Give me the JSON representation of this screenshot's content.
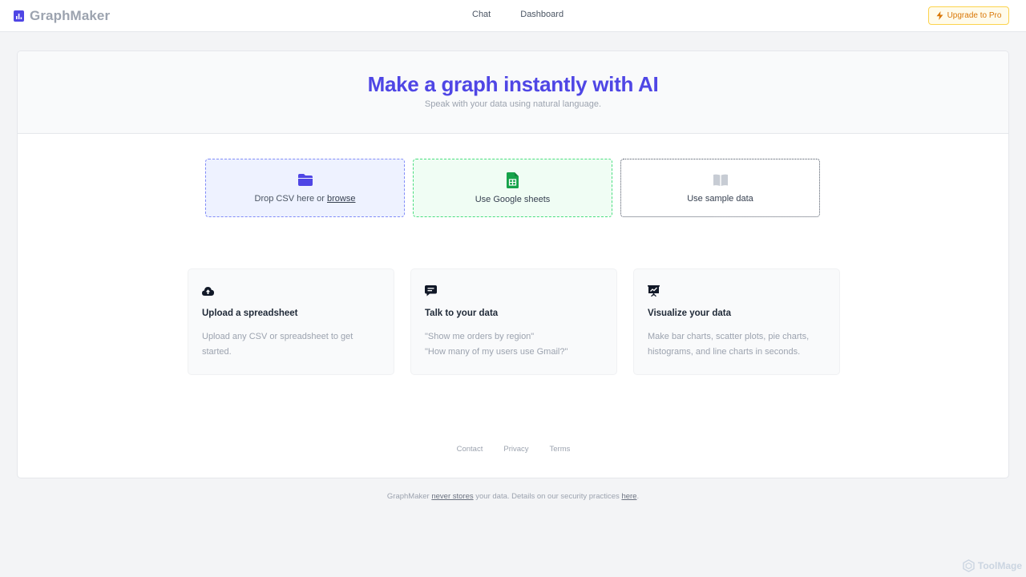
{
  "brand": {
    "name": "GraphMaker"
  },
  "nav": {
    "chat": "Chat",
    "dashboard": "Dashboard"
  },
  "upgrade": {
    "label": "Upgrade to Pro"
  },
  "hero": {
    "title": "Make a graph instantly with AI",
    "subtitle": "Speak with your data using natural language."
  },
  "sources": {
    "csv_prefix": "Drop CSV here or ",
    "csv_link": "browse",
    "sheets": "Use Google sheets",
    "sample": "Use sample data"
  },
  "features": [
    {
      "title": "Upload a spreadsheet",
      "line1": "Upload any CSV or spreadsheet to get",
      "line2": "started."
    },
    {
      "title": "Talk to your data",
      "line1": "\"Show me orders by region\"",
      "line2": "\"How many of my users use Gmail?\""
    },
    {
      "title": "Visualize your data",
      "line1": "Make bar charts, scatter plots, pie charts,",
      "line2": "histograms, and line charts in seconds."
    }
  ],
  "footer": {
    "contact": "Contact",
    "privacy": "Privacy",
    "terms": "Terms"
  },
  "notice": {
    "p1": "GraphMaker ",
    "link1": "never stores",
    "p2": " your data. Details on our security practices ",
    "link2": "here",
    "p3": "."
  },
  "watermark": {
    "text": "ToolMage"
  },
  "colors": {
    "accent": "#4f46e5",
    "sheets": "#16a34a",
    "upgrade": "#d97706"
  }
}
